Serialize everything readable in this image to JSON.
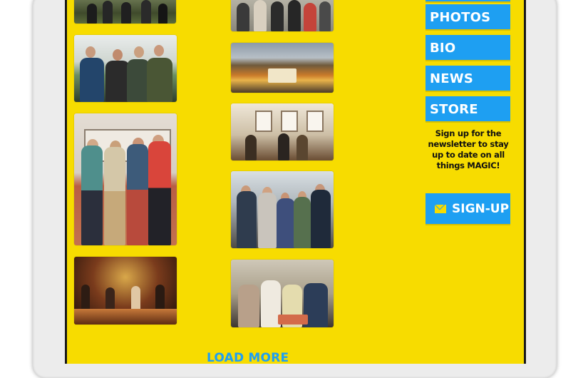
{
  "sidebar": {
    "nav_items": [
      {
        "label": "PHOTOS"
      },
      {
        "label": "BIO"
      },
      {
        "label": "NEWS"
      },
      {
        "label": "STORE"
      }
    ],
    "newsletter_text": "Sign up for the newsletter to stay up to date on all things MAGIC!",
    "signup_label": "SIGN-UP"
  },
  "gallery": {
    "load_more_label": "LOAD MORE",
    "photos": [
      {
        "name": "photo-band-outdoor-top"
      },
      {
        "name": "photo-band-green-room"
      },
      {
        "name": "photo-band-standing-wall"
      },
      {
        "name": "photo-band-concert-stage"
      },
      {
        "name": "photo-group-top"
      },
      {
        "name": "photo-stadium-crowd"
      },
      {
        "name": "photo-band-studio-session"
      },
      {
        "name": "photo-band-with-fans"
      },
      {
        "name": "photo-band-on-couch"
      }
    ]
  },
  "colors": {
    "page_background": "#f7dc00",
    "button_blue": "#1e9ff2",
    "button_text": "#ffffff"
  },
  "icons": {
    "signup_icon": "envelope-icon"
  }
}
